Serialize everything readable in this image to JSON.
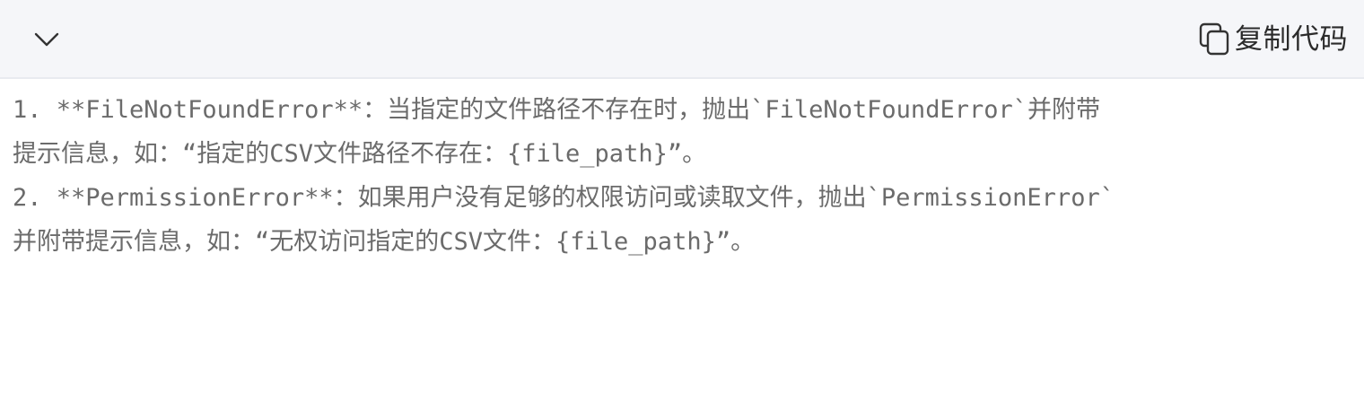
{
  "header": {
    "copy_label": "复制代码"
  },
  "code": {
    "lines": [
      "1. **FileNotFoundError**：当指定的文件路径不存在时，抛出`FileNotFoundError`并附带",
      "提示信息，如：“指定的CSV文件路径不存在：{file_path}”。",
      "2. **PermissionError**：如果用户没有足够的权限访问或读取文件，抛出`PermissionError`",
      "并附带提示信息，如：“无权访问指定的CSV文件：{file_path}”。"
    ]
  },
  "icons": {
    "collapse": "chevron-down-icon",
    "copy": "copy-icon"
  },
  "colors": {
    "header_bg": "#f5f6f9",
    "text": "#6b6b6b",
    "label": "#2b2b2b"
  }
}
